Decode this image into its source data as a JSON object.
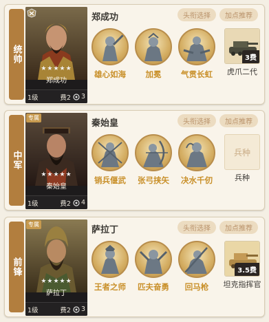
{
  "panels": [
    {
      "position": "统帅",
      "badge": "",
      "hero_name": "郑成功",
      "stars": "★★★★★",
      "level": "1级",
      "cost": "费2",
      "count": "3",
      "title_button": "头衔选择",
      "points_button": "加点推荐",
      "skills": [
        "雄心如海",
        "加冕",
        "气贯长虹"
      ],
      "unit_name": "虎爪二代",
      "unit_cost": "3费",
      "unit_empty_label": ""
    },
    {
      "position": "中军",
      "badge": "专属",
      "hero_name": "秦始皇",
      "stars": "★★★★★",
      "level": "1级",
      "cost": "费2",
      "count": "4",
      "title_button": "头衔选择",
      "points_button": "加点推荐",
      "skills": [
        "销兵偃武",
        "张弓挟矢",
        "决水千仞"
      ],
      "unit_name": "兵种",
      "unit_cost": "",
      "unit_empty_label": "兵种"
    },
    {
      "position": "前锋",
      "badge": "专属",
      "hero_name": "萨拉丁",
      "stars": "★★★★★",
      "level": "1级",
      "cost": "费2",
      "count": "3",
      "title_button": "头衔选择",
      "points_button": "加点推荐",
      "skills": [
        "王者之师",
        "匹夫奋勇",
        "回马枪"
      ],
      "unit_name": "坦克指挥官",
      "unit_cost": "3.5费",
      "unit_empty_label": ""
    }
  ],
  "colors": {
    "tab": "#b27e3e",
    "skill_text": "#c9902a",
    "button_bg": "#ecdcc1",
    "button_text": "#b9926a"
  },
  "icons": {
    "rank": "rank-crest-icon",
    "card_icon": "card-indicator-icon"
  }
}
